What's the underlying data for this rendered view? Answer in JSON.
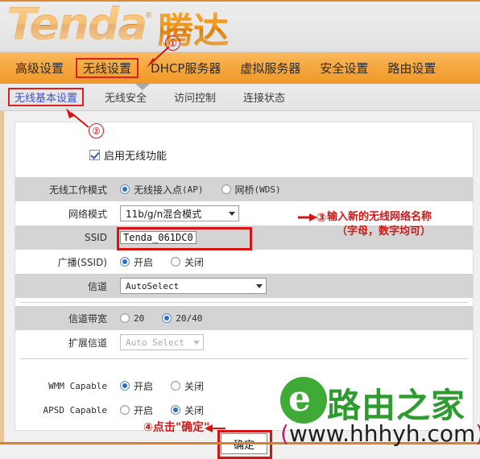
{
  "brand": {
    "logo_text": "Tenda",
    "registered_mark": "®",
    "chinese_name": "腾达"
  },
  "nav": {
    "items": [
      {
        "label": "高级设置",
        "selected": false
      },
      {
        "label": "无线设置",
        "selected": true
      },
      {
        "label": "DHCP服务器",
        "selected": false
      },
      {
        "label": "虚拟服务器",
        "selected": false
      },
      {
        "label": "安全设置",
        "selected": false
      },
      {
        "label": "路由设置",
        "selected": false
      }
    ]
  },
  "subnav": {
    "items": [
      {
        "label": "无线基本设置",
        "selected": true
      },
      {
        "label": "无线安全",
        "selected": false
      },
      {
        "label": "访问控制",
        "selected": false
      },
      {
        "label": "连接状态",
        "selected": false
      }
    ]
  },
  "form": {
    "enable_wireless": {
      "label": "启用无线功能",
      "checked": true
    },
    "work_mode": {
      "label": "无线工作模式",
      "options": [
        {
          "label": "无线接入点",
          "suffix": "(AP)",
          "selected": true
        },
        {
          "label": "网桥",
          "suffix": "(WDS)",
          "selected": false
        }
      ]
    },
    "network_mode": {
      "label": "网络模式",
      "value": "11b/g/n混合模式"
    },
    "ssid": {
      "label": "SSID",
      "value": "Tenda_061DC0"
    },
    "broadcast": {
      "label": "广播(SSID)",
      "options": [
        {
          "label": "开启",
          "selected": true
        },
        {
          "label": "关闭",
          "selected": false
        }
      ]
    },
    "channel": {
      "label": "信道",
      "value": "AutoSelect"
    },
    "channel_bandwidth": {
      "label": "信道带宽",
      "options": [
        {
          "label": "20",
          "selected": false
        },
        {
          "label": "20/40",
          "selected": true
        }
      ]
    },
    "extension_channel": {
      "label": "扩展信道",
      "value": "Auto Select",
      "disabled": true
    },
    "wmm_capable": {
      "label": "WMM Capable",
      "options": [
        {
          "label": "开启",
          "selected": true
        },
        {
          "label": "关闭",
          "selected": false
        }
      ]
    },
    "apsd_capable": {
      "label": "APSD Capable",
      "options": [
        {
          "label": "开启",
          "selected": false
        },
        {
          "label": "关闭",
          "selected": true
        }
      ]
    },
    "submit_label": "确定"
  },
  "annotations": {
    "step1": {
      "marker": "①"
    },
    "step2": {
      "marker": "②"
    },
    "step3": {
      "marker": "③",
      "line1": "输入新的无线网络名称",
      "line2": "（字母，数字均可）"
    },
    "step4": {
      "text": "④点击\"确定\""
    }
  },
  "watermark": {
    "logo_glyph": "e",
    "name": "路由之家",
    "url_open": "(",
    "url": "www.hhhyh.com",
    "url_close": ")"
  },
  "colors": {
    "brand_orange": "#f0982a",
    "annotation_red": "#d61414",
    "watermark_green": "#2e9b2e",
    "row_gray": "#d4d4d4"
  }
}
